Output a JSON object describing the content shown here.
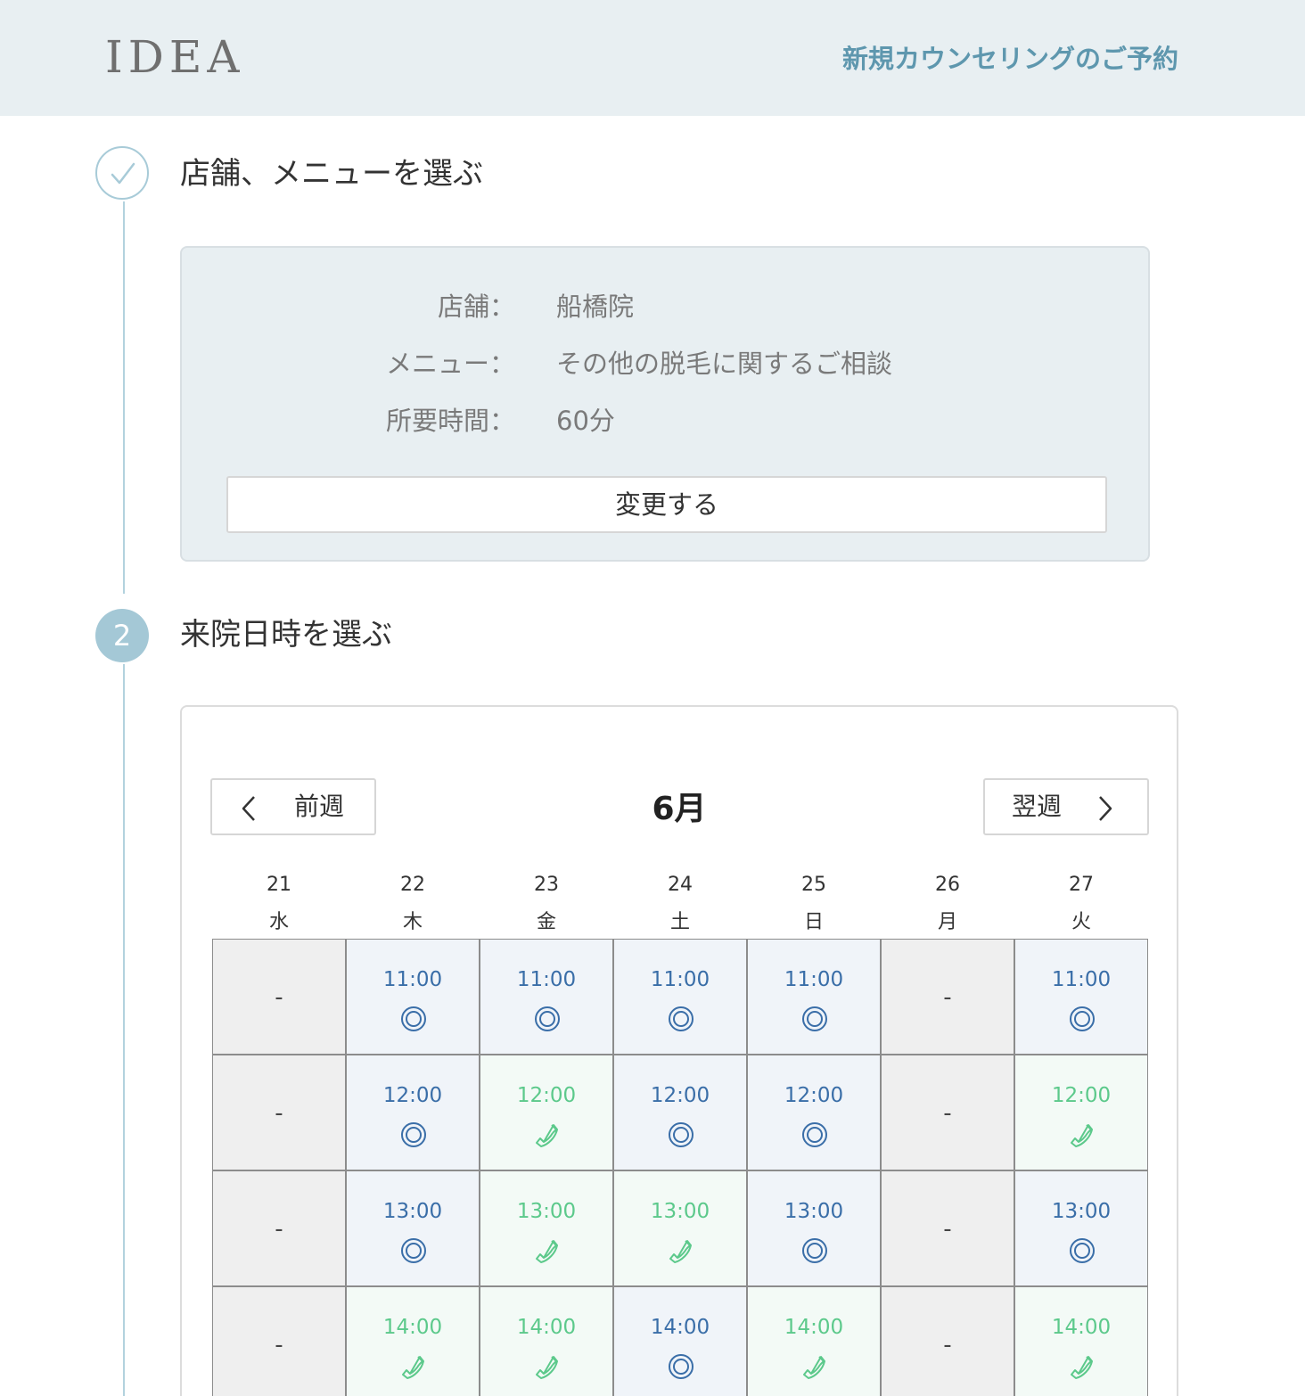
{
  "header": {
    "logo": "IDEA",
    "reserve_link": "新規カウンセリングのご予約"
  },
  "step1": {
    "title": "店舗、メニューを選ぶ",
    "rows": [
      {
        "label": "店舗：",
        "value": "船橋院"
      },
      {
        "label": "メニュー：",
        "value": "その他の脱毛に関するご相談"
      },
      {
        "label": "所要時間：",
        "value": "60分"
      }
    ],
    "change_button": "変更する"
  },
  "step2": {
    "number": "2",
    "title": "来院日時を選ぶ"
  },
  "calendar": {
    "prev_label": "前週",
    "next_label": "翌週",
    "month": "6月",
    "days": [
      {
        "date": "21",
        "weekday": "水"
      },
      {
        "date": "22",
        "weekday": "木"
      },
      {
        "date": "23",
        "weekday": "金"
      },
      {
        "date": "24",
        "weekday": "土"
      },
      {
        "date": "25",
        "weekday": "日"
      },
      {
        "date": "26",
        "weekday": "月"
      },
      {
        "date": "27",
        "weekday": "火"
      }
    ],
    "unavailable_text": "-",
    "legend_icons": {
      "web": "double-circle-icon",
      "tel": "phone-icon"
    },
    "colors": {
      "web": "#3a6ea8",
      "tel": "#5cc98b",
      "unavailable_bg": "#efefef"
    },
    "rows": [
      {
        "time": "11:00",
        "slots": [
          "none",
          "web",
          "web",
          "web",
          "web",
          "none",
          "web"
        ]
      },
      {
        "time": "12:00",
        "slots": [
          "none",
          "web",
          "tel",
          "web",
          "web",
          "none",
          "tel"
        ]
      },
      {
        "time": "13:00",
        "slots": [
          "none",
          "web",
          "tel",
          "tel",
          "web",
          "none",
          "web"
        ]
      },
      {
        "time": "14:00",
        "slots": [
          "none",
          "tel",
          "tel",
          "web",
          "tel",
          "none",
          "tel"
        ]
      }
    ]
  }
}
